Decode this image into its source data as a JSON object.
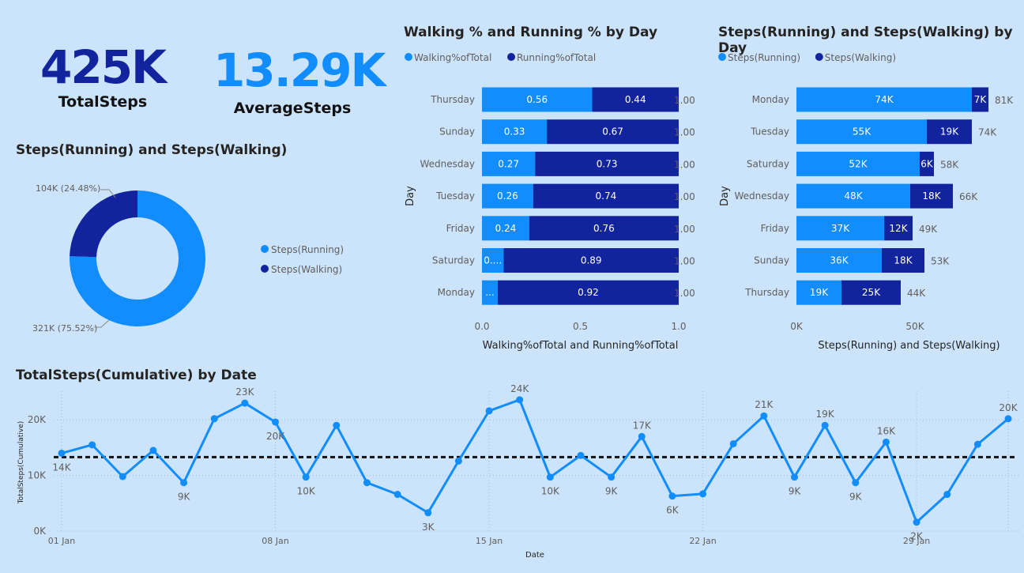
{
  "kpis": {
    "total": {
      "value": "425K",
      "label": "TotalSteps"
    },
    "average": {
      "value": "13.29K",
      "label": "AverageSteps"
    }
  },
  "colors": {
    "running": "#118dff",
    "walking": "#12239e",
    "text": "#252423",
    "muted": "#605e5c",
    "background": "#cce4fb"
  },
  "chart_data": [
    {
      "type": "pie",
      "title": "Steps(Running) and Steps(Walking)",
      "legend_position": "right",
      "series": [
        {
          "name": "Steps(Running)",
          "value": 321,
          "label": "321K (75.52%)"
        },
        {
          "name": "Steps(Walking)",
          "value": 104,
          "label": "104K (24.48%)"
        }
      ]
    },
    {
      "type": "bar",
      "orientation": "horizontal",
      "stacked": true,
      "title": "Walking % and Running % by Day",
      "xlabel": "Walking%ofTotal and Running%ofTotal",
      "ylabel": "Day",
      "xlim": [
        0,
        1
      ],
      "xticks": [
        "0.0",
        "0.5",
        "1.0"
      ],
      "legend_position": "top-left",
      "categories": [
        "Thursday",
        "Sunday",
        "Wednesday",
        "Tuesday",
        "Friday",
        "Saturday",
        "Monday"
      ],
      "series": [
        {
          "name": "Walking%ofTotal",
          "values": [
            0.56,
            0.33,
            0.27,
            0.26,
            0.24,
            0.11,
            0.08
          ],
          "labels": [
            "0.56",
            "0.33",
            "0.27",
            "0.26",
            "0.24",
            "0....",
            "..."
          ]
        },
        {
          "name": "Running%ofTotal",
          "values": [
            0.44,
            0.67,
            0.73,
            0.74,
            0.76,
            0.89,
            0.92
          ],
          "labels": [
            "0.44",
            "0.67",
            "0.73",
            "0.74",
            "0.76",
            "0.89",
            "0.92"
          ]
        }
      ],
      "totals": [
        "1.00",
        "1.00",
        "1.00",
        "1.00",
        "1.00",
        "1.00",
        "1.00"
      ]
    },
    {
      "type": "bar",
      "orientation": "horizontal",
      "stacked": true,
      "title": "Steps(Running) and Steps(Walking) by Day",
      "xlabel": "Steps(Running) and Steps(Walking)",
      "ylabel": "Day",
      "xlim": [
        0,
        95
      ],
      "xticks": [
        {
          "value": 0,
          "label": "0K"
        },
        {
          "value": 50,
          "label": "50K"
        }
      ],
      "legend_position": "top-left",
      "categories": [
        "Monday",
        "Tuesday",
        "Saturday",
        "Wednesday",
        "Friday",
        "Sunday",
        "Thursday"
      ],
      "series": [
        {
          "name": "Steps(Running)",
          "values": [
            74,
            55,
            52,
            48,
            37,
            36,
            19
          ],
          "labels": [
            "74K",
            "55K",
            "52K",
            "48K",
            "37K",
            "36K",
            "19K"
          ]
        },
        {
          "name": "Steps(Walking)",
          "values": [
            7,
            19,
            6,
            18,
            12,
            18,
            25
          ],
          "labels": [
            "7K",
            "19K",
            "6K",
            "18K",
            "12K",
            "18K",
            "25K"
          ]
        }
      ],
      "totals": [
        "81K",
        "74K",
        "58K",
        "66K",
        "49K",
        "53K",
        "44K"
      ]
    },
    {
      "type": "line",
      "title": "TotalSteps(Cumulative) by Date",
      "xlabel": "Date",
      "ylabel": "TotalSteps(Cumulative)",
      "ylim": [
        0,
        24
      ],
      "yticks": [
        {
          "value": 0,
          "label": "0K"
        },
        {
          "value": 10,
          "label": "10K"
        },
        {
          "value": 20,
          "label": "20K"
        }
      ],
      "xticks": [
        {
          "day": 1,
          "label": "01 Jan"
        },
        {
          "day": 8,
          "label": "08 Jan"
        },
        {
          "day": 15,
          "label": "15 Jan"
        },
        {
          "day": 22,
          "label": "22 Jan"
        },
        {
          "day": 29,
          "label": "29 Jan"
        }
      ],
      "average_line": 13.29,
      "series": [
        {
          "name": "TotalSteps(Cumulative)",
          "x": [
            1,
            2,
            3,
            4,
            5,
            6,
            7,
            8,
            9,
            10,
            11,
            12,
            13,
            14,
            15,
            16,
            17,
            18,
            19,
            20,
            21,
            22,
            23,
            24,
            25,
            26,
            27,
            28,
            29,
            30,
            31,
            32
          ],
          "y": [
            14,
            15.5,
            9.8,
            14.5,
            8.7,
            20.2,
            23,
            19.6,
            9.7,
            19,
            8.7,
            6.6,
            3.3,
            12.6,
            21.6,
            23.6,
            9.7,
            13.6,
            9.7,
            17,
            6.3,
            6.7,
            15.7,
            20.7,
            9.7,
            19,
            8.7,
            16,
            1.6,
            6.6,
            15.6,
            20.2
          ],
          "point_labels": [
            {
              "index": 0,
              "label": "14K"
            },
            {
              "index": 4,
              "label": "9K"
            },
            {
              "index": 6,
              "label": "23K"
            },
            {
              "index": 7,
              "label": "20K"
            },
            {
              "index": 8,
              "label": "10K"
            },
            {
              "index": 12,
              "label": "3K"
            },
            {
              "index": 15,
              "label": "24K"
            },
            {
              "index": 16,
              "label": "10K"
            },
            {
              "index": 18,
              "label": "9K"
            },
            {
              "index": 19,
              "label": "17K"
            },
            {
              "index": 20,
              "label": "6K"
            },
            {
              "index": 23,
              "label": "21K"
            },
            {
              "index": 24,
              "label": "9K"
            },
            {
              "index": 25,
              "label": "19K"
            },
            {
              "index": 26,
              "label": "9K"
            },
            {
              "index": 27,
              "label": "16K"
            },
            {
              "index": 28,
              "label": "2K"
            },
            {
              "index": 31,
              "label": "20K"
            }
          ]
        }
      ]
    }
  ]
}
